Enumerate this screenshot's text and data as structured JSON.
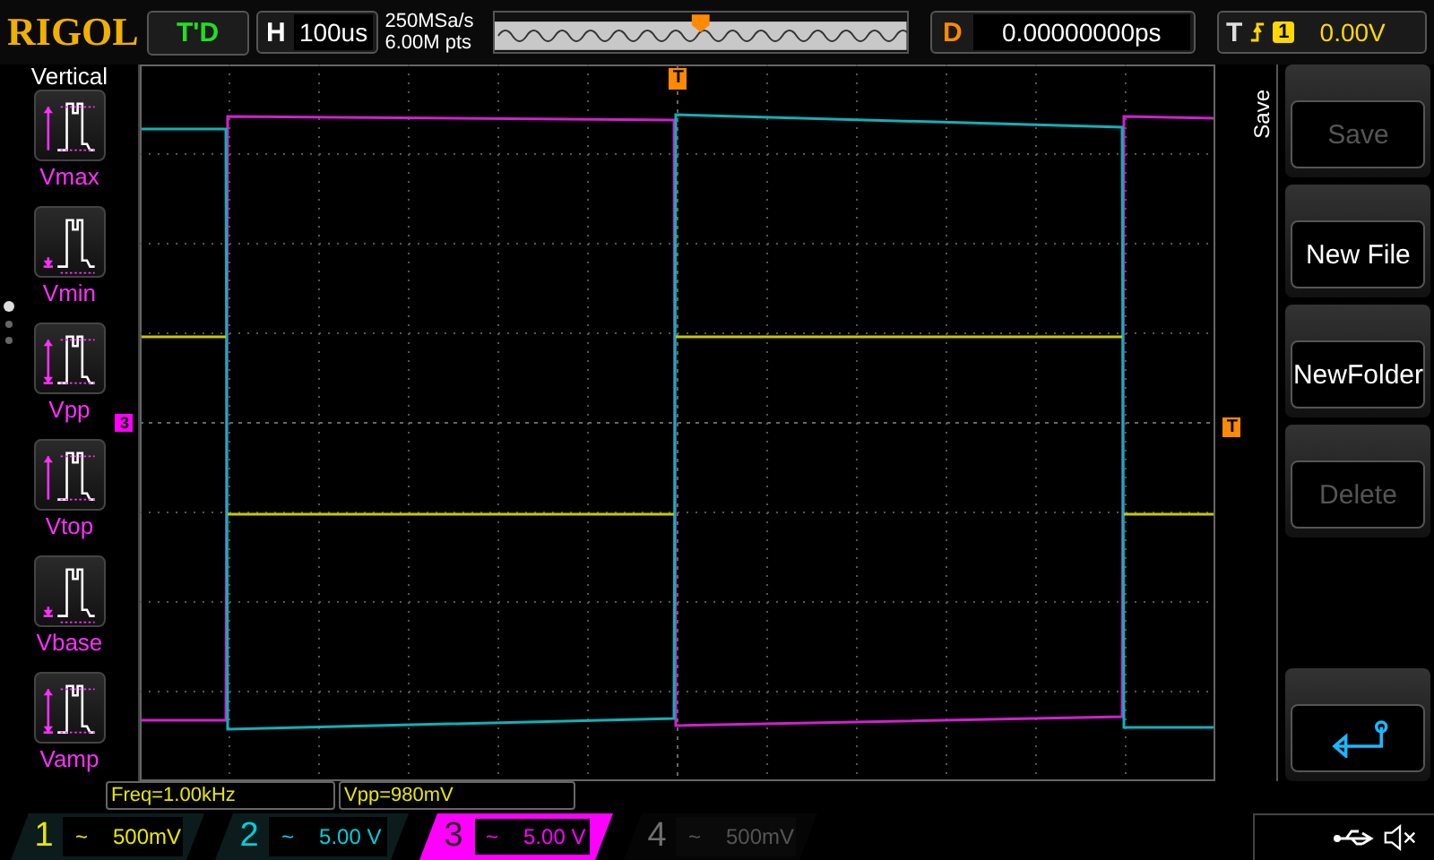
{
  "top_bar": {
    "logo": "RIGOL",
    "run_status": "T'D",
    "horizontal": {
      "label": "H",
      "value": "100us"
    },
    "sample_rate": "250MSa/s",
    "memory_depth": "6.00M pts",
    "delay": {
      "label": "D",
      "value": "0.00000000ps"
    },
    "trigger": {
      "label": "T",
      "source": "1",
      "level": "0.00V"
    }
  },
  "left_menu": {
    "title": "Vertical",
    "items": [
      {
        "label": "Vmax"
      },
      {
        "label": "Vmin"
      },
      {
        "label": "Vpp"
      },
      {
        "label": "Vtop"
      },
      {
        "label": "Vbase"
      },
      {
        "label": "Vamp"
      }
    ],
    "pages": [
      {
        "selected": true
      },
      {
        "selected": false
      },
      {
        "selected": false
      }
    ]
  },
  "plot": {
    "channel_marker": "3",
    "trigger_position_marker": "T",
    "trigger_level_marker": "T"
  },
  "right_menu": {
    "title": "Save",
    "buttons": [
      {
        "kind": "text",
        "label": "Save",
        "disabled": true
      },
      {
        "kind": "text",
        "label": "New File",
        "disabled": false
      },
      {
        "kind": "text",
        "label": "NewFolder",
        "disabled": false
      },
      {
        "kind": "text",
        "label": "Delete",
        "disabled": true
      },
      {
        "kind": "back"
      }
    ]
  },
  "measurements": [
    "Freq=1.00kHz",
    "Vpp=980mV"
  ],
  "channels": [
    {
      "number": "1",
      "coupling": "~",
      "scale": "500mV",
      "color": "#e8e800",
      "on": true,
      "selected": false
    },
    {
      "number": "2",
      "coupling": "~",
      "scale": "5.00 V",
      "color": "#00d0d8",
      "on": true,
      "selected": false
    },
    {
      "number": "3",
      "coupling": "~",
      "scale": "5.00 V",
      "color": "#ff00ff",
      "on": true,
      "selected": true
    },
    {
      "number": "4",
      "coupling": "~",
      "scale": "500mV",
      "color": "#707070",
      "on": false,
      "selected": false
    }
  ]
}
